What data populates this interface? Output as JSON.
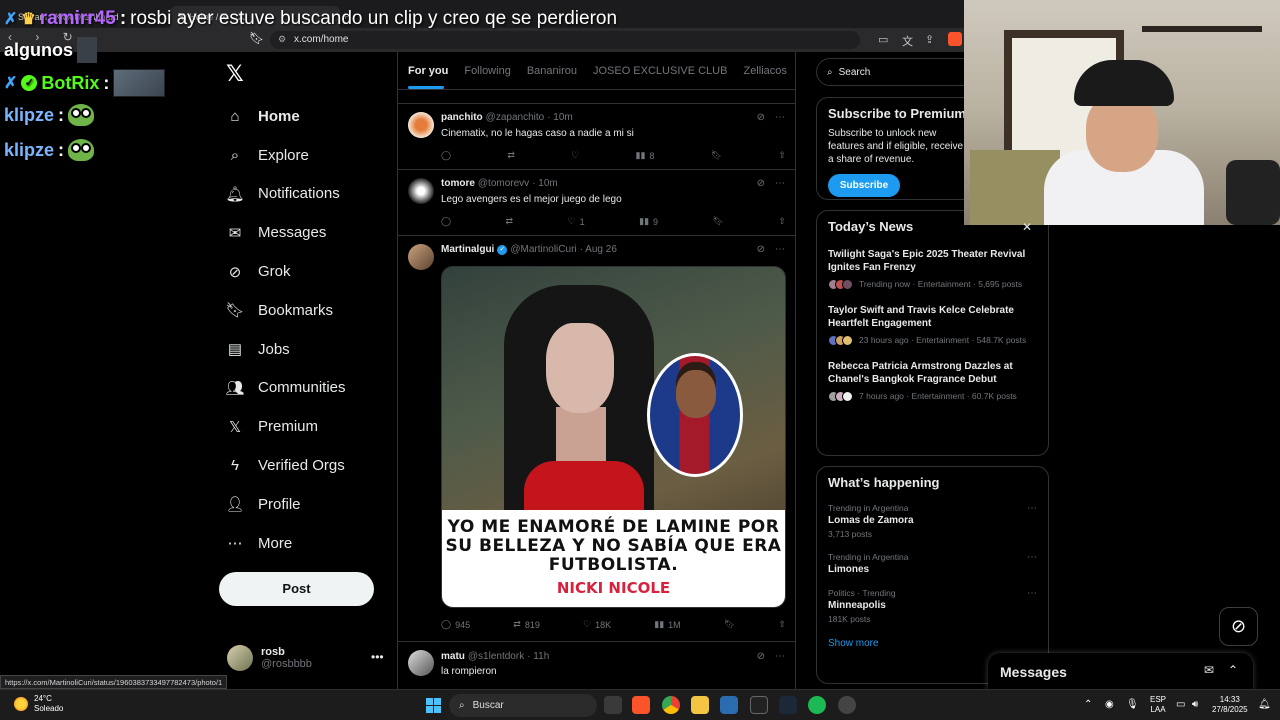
{
  "browser": {
    "tabs": [
      {
        "label": "Stream - Kick Dashboard"
      },
      {
        "label": "Home / X"
      }
    ],
    "url": "x.com/home",
    "status_url": "https://x.com/MartinoliCuri/status/1960383733497782473/photo/1"
  },
  "stream_chat": {
    "first": {
      "user": "ramirr45",
      "message": "rosbi ayer estuve buscando un clip y creo qe se perdieron",
      "continuation": "algunos"
    },
    "lines": [
      {
        "user": "BotRix"
      },
      {
        "user": "klipze"
      },
      {
        "user": "klipze"
      }
    ]
  },
  "nav": {
    "items": [
      {
        "label": "Home",
        "icon": "home-icon"
      },
      {
        "label": "Explore",
        "icon": "search-icon"
      },
      {
        "label": "Notifications",
        "icon": "bell-icon"
      },
      {
        "label": "Messages",
        "icon": "envelope-icon"
      },
      {
        "label": "Grok",
        "icon": "grok-icon"
      },
      {
        "label": "Bookmarks",
        "icon": "bookmark-icon"
      },
      {
        "label": "Jobs",
        "icon": "briefcase-icon"
      },
      {
        "label": "Communities",
        "icon": "communities-icon"
      },
      {
        "label": "Premium",
        "icon": "x-icon"
      },
      {
        "label": "Verified Orgs",
        "icon": "lightning-icon"
      },
      {
        "label": "Profile",
        "icon": "person-icon"
      },
      {
        "label": "More",
        "icon": "more-circle-icon"
      }
    ],
    "post_label": "Post",
    "account": {
      "name": "rosb",
      "handle": "@rosbbbb"
    }
  },
  "feed": {
    "tabs": [
      "For you",
      "Following",
      "Bananirou",
      "JOSEO EXCLUSIVE CLUB",
      "Zelliacos"
    ],
    "tweets": [
      {
        "name": "panchito",
        "handle": "@zapanchito",
        "time": "· 10m",
        "text": "Cinematix, no le hagas caso a nadie a mi si",
        "replies": "",
        "reposts": "",
        "likes": "",
        "views": "8"
      },
      {
        "name": "tomore",
        "handle": "@tomorevv",
        "time": "· 10m",
        "text": "Lego avengers es el mejor juego de lego",
        "replies": "",
        "reposts": "",
        "likes": "1",
        "views": "9"
      },
      {
        "name": "Martinalgui",
        "handle": "@MartinoliCuri",
        "time": "· Aug 26",
        "text": "",
        "replies": "945",
        "reposts": "819",
        "likes": "18K",
        "views": "1M",
        "media_caption": "YO ME ENAMORÉ DE LAMINE POR SU BELLEZA Y NO SABÍA QUE ERA FUTBOLISTA.",
        "media_credit": "NICKI NICOLE"
      },
      {
        "name": "matu",
        "handle": "@s1lentdork",
        "time": "· 11h",
        "text": "la rompieron"
      }
    ]
  },
  "sidebar": {
    "search_placeholder": "Search",
    "premium": {
      "title": "Subscribe to Premium",
      "text": "Subscribe to unlock new features and if eligible, receive a share of revenue.",
      "button": "Subscribe"
    },
    "news": {
      "title": "Today’s News",
      "items": [
        {
          "headline": "Twilight Saga's Epic 2025 Theater Revival Ignites Fan Frenzy",
          "meta": "Trending now · Entertainment · 5,695 posts"
        },
        {
          "headline": "Taylor Swift and Travis Kelce Celebrate Heartfelt Engagement",
          "meta": "23 hours ago · Entertainment · 548.7K posts"
        },
        {
          "headline": "Rebecca Patricia Armstrong Dazzles at Chanel's Bangkok Fragrance Debut",
          "meta": "7 hours ago · Entertainment · 60.7K posts"
        }
      ]
    },
    "happening": {
      "title": "What’s happening",
      "items": [
        {
          "category": "Trending in Argentina",
          "name": "Lomas de Zamora",
          "count": "3,713 posts"
        },
        {
          "category": "Trending in Argentina",
          "name": "Limones",
          "count": ""
        },
        {
          "category": "Politics · Trending",
          "name": "Minneapolis",
          "count": "181K posts"
        }
      ],
      "show_more": "Show more"
    }
  },
  "messages_drawer": {
    "title": "Messages"
  },
  "taskbar": {
    "weather": {
      "temp": "24°C",
      "desc": "Soleado"
    },
    "search": "Buscar",
    "lang": {
      "top": "ESP",
      "bottom": "LAA"
    },
    "clock": {
      "time": "14:33",
      "date": "27/8/2025"
    }
  },
  "colors": {
    "accent": "#1d9bf0",
    "kick_green": "#53fc18",
    "background": "#000000"
  }
}
